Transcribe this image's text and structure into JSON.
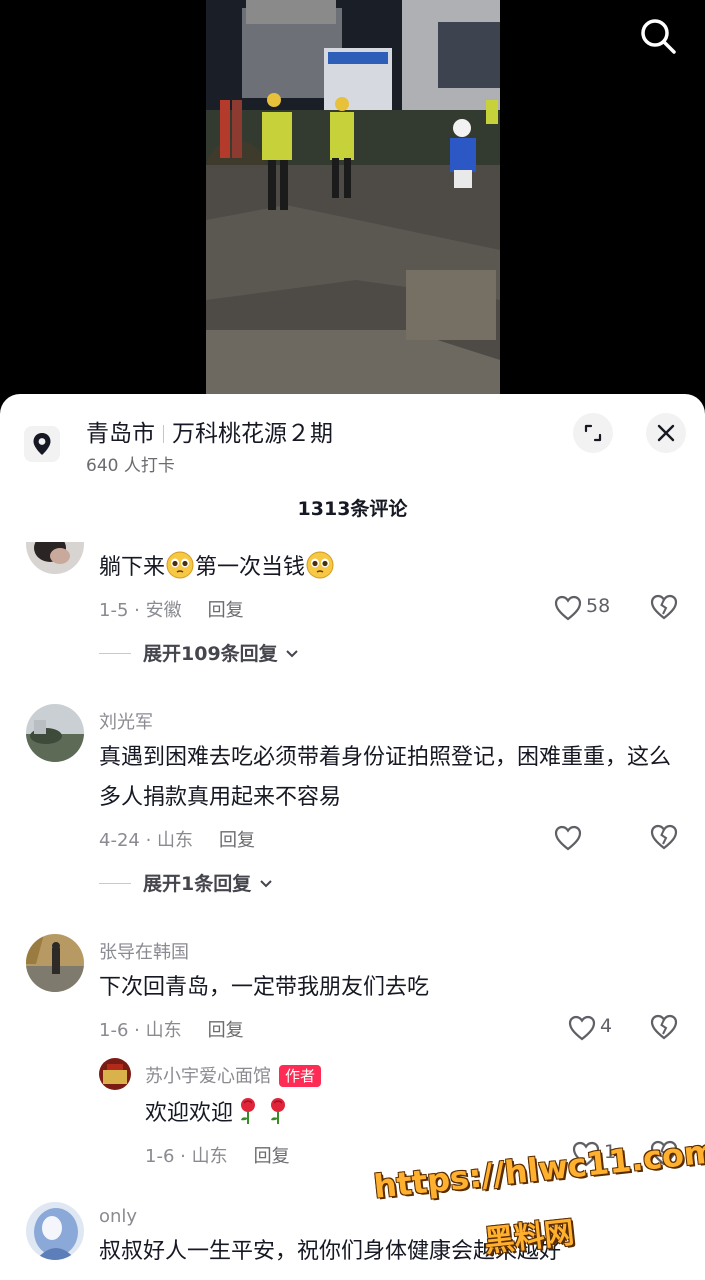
{
  "location": {
    "city": "青岛市",
    "place": "万科桃花源２期",
    "checkins": "640 人打卡"
  },
  "comments_header": {
    "count_label": "1313条评论"
  },
  "colors": {
    "primary_text": "#161823",
    "secondary_text": "#8a8b91",
    "author_tag": "#fe2c55",
    "sheet_bg": "#ffffff"
  },
  "comments": [
    {
      "text_before": "躺下来",
      "text_middle": "第一次当钱",
      "emoji": "pleading-face",
      "meta": "1-5 · 安徽",
      "reply_label": "回复",
      "likes": "58",
      "expand_label": "展开109条回复"
    },
    {
      "user": "刘光军",
      "text": "真遇到困难去吃必须带着身份证拍照登记，困难重重，这么多人捐款真用起来不容易",
      "meta": "4-24 · 山东",
      "reply_label": "回复",
      "likes": "",
      "expand_label": "展开1条回复"
    },
    {
      "user": "张导在韩国",
      "text": "下次回青岛，一定带我朋友们去吃",
      "meta": "1-6 · 山东",
      "reply_label": "回复",
      "likes": "4",
      "reply": {
        "user": "苏小宇爱心面馆",
        "tag": "作者",
        "text": "欢迎欢迎",
        "emoji": "rose",
        "meta": "1-6 · 山东",
        "reply_label": "回复",
        "likes": "1"
      }
    },
    {
      "user": "only",
      "text": "叔叔好人一生平安，祝你们身体健康会越来越好"
    }
  ],
  "watermark": {
    "url": "https://hlwc11.com",
    "name": "黑料网"
  }
}
